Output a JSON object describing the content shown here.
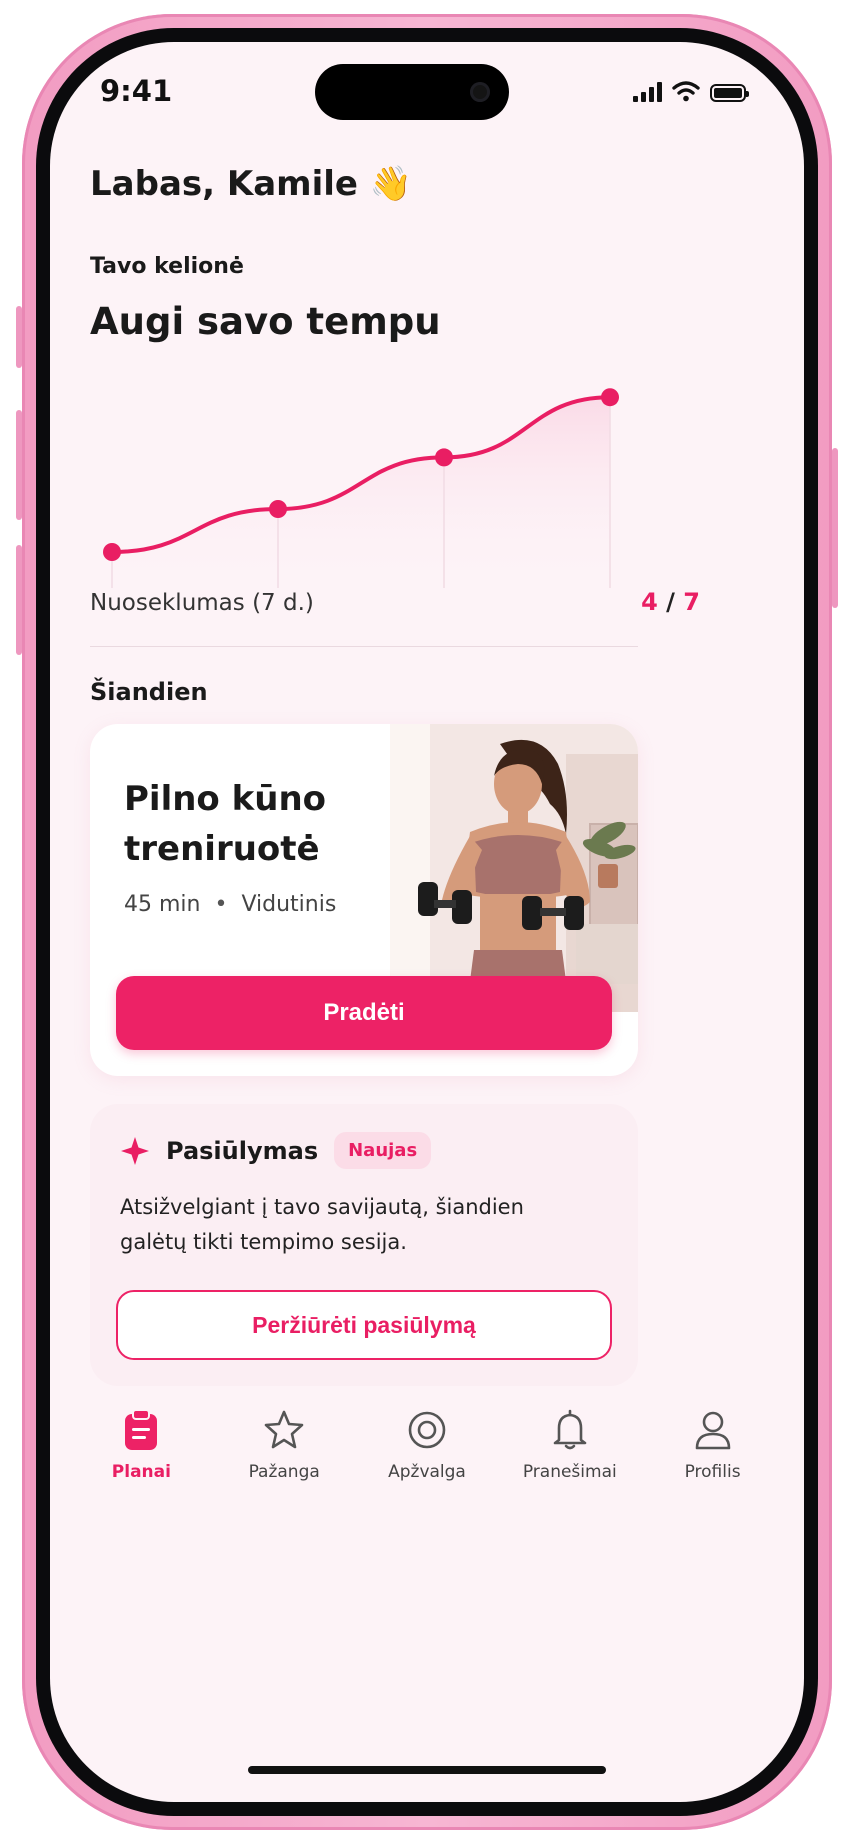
{
  "status": {
    "time": "9:41"
  },
  "greeting": "Labas, Kamile 👋",
  "journey": {
    "label": "Tavo kelionė",
    "title": "Augi savo tempu",
    "consistency_label": "Nuoseklumas (7 d.)",
    "consistency_done": "4",
    "consistency_sep": " / ",
    "consistency_total": "7"
  },
  "today": {
    "section_label": "Šiandien",
    "workout_title": "Pilno kūno treniruotė",
    "duration": "45 min",
    "meta_sep": "•",
    "level": "Vidutinis",
    "start_button": "Pradėti"
  },
  "suggestion": {
    "title": "Pasiūlymas",
    "badge": "Naujas",
    "text": "Atsižvelgiant į tavo savijautą, šiandien galėtų tikti tempimo sesija.",
    "button": "Peržiūrėti pasiūlymą"
  },
  "tabs": [
    {
      "label": "Planai",
      "icon": "clipboard-icon",
      "active": true
    },
    {
      "label": "Pažanga",
      "icon": "star-icon",
      "active": false
    },
    {
      "label": "Apžvalga",
      "icon": "target-icon",
      "active": false
    },
    {
      "label": "Pranešimai",
      "icon": "bell-icon",
      "active": false
    },
    {
      "label": "Profilis",
      "icon": "user-icon",
      "active": false
    }
  ],
  "colors": {
    "accent": "#ed2266",
    "background": "#fdf3f7",
    "frame": "#f4a6c8"
  },
  "progress_chart": {
    "type": "line",
    "points": [
      1,
      2,
      3,
      4
    ],
    "values": [
      0.0,
      0.25,
      0.55,
      0.9
    ]
  }
}
